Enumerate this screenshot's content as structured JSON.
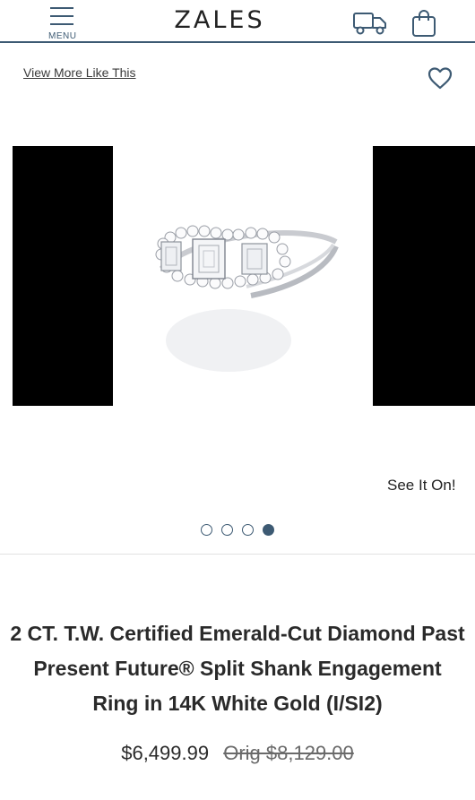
{
  "header": {
    "menu_label": "MENU",
    "logo_text": "ZALES"
  },
  "subbar": {
    "view_more_label": "View More Like This"
  },
  "gallery": {
    "see_it_on_label": "See It On!",
    "slide_count": 4,
    "active_slide": 4
  },
  "product": {
    "title": "2 CT. T.W. Certified Emerald-Cut Diamond Past Present Future® Split Shank Engagement Ring in 14K White Gold (I/SI2)",
    "price": "$6,499.99",
    "orig_price": "Orig $8,129.00"
  },
  "colors": {
    "accent": "#3d5a73"
  }
}
